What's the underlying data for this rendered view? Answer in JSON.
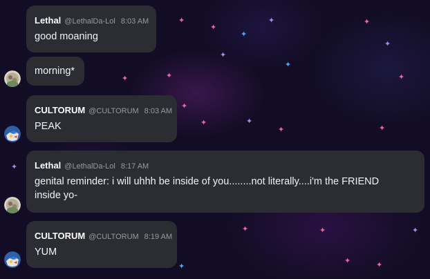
{
  "messages": [
    {
      "author": "Lethal",
      "handle": "@LethalDa-Lol",
      "time": "8:03 AM",
      "text": "good moaning"
    },
    {
      "text": "morning*"
    },
    {
      "author": "CULTORUM",
      "handle": "@CULTORUM",
      "time": "8:03 AM",
      "text": "PEAK"
    },
    {
      "author": "Lethal",
      "handle": "@LethalDa-Lol",
      "time": "8:17 AM",
      "text": "genital reminder: i will uhhh be inside of you........not literally....i'm the FRIEND inside yo-"
    },
    {
      "author": "CULTORUM",
      "handle": "@CULTORUM",
      "time": "8:19 AM",
      "text": "YUM"
    }
  ],
  "avatars": {
    "lethal": "lethal-avatar",
    "cultorum": "cultorum-avatar"
  },
  "colors": {
    "background": "#120d24",
    "bubble": "#2b2d33",
    "text": "#f2f3f5",
    "muted": "#949ba4",
    "star_pink": "#e86aa4",
    "star_blue": "#4aa8ff",
    "star_violet": "#a88ae8"
  }
}
